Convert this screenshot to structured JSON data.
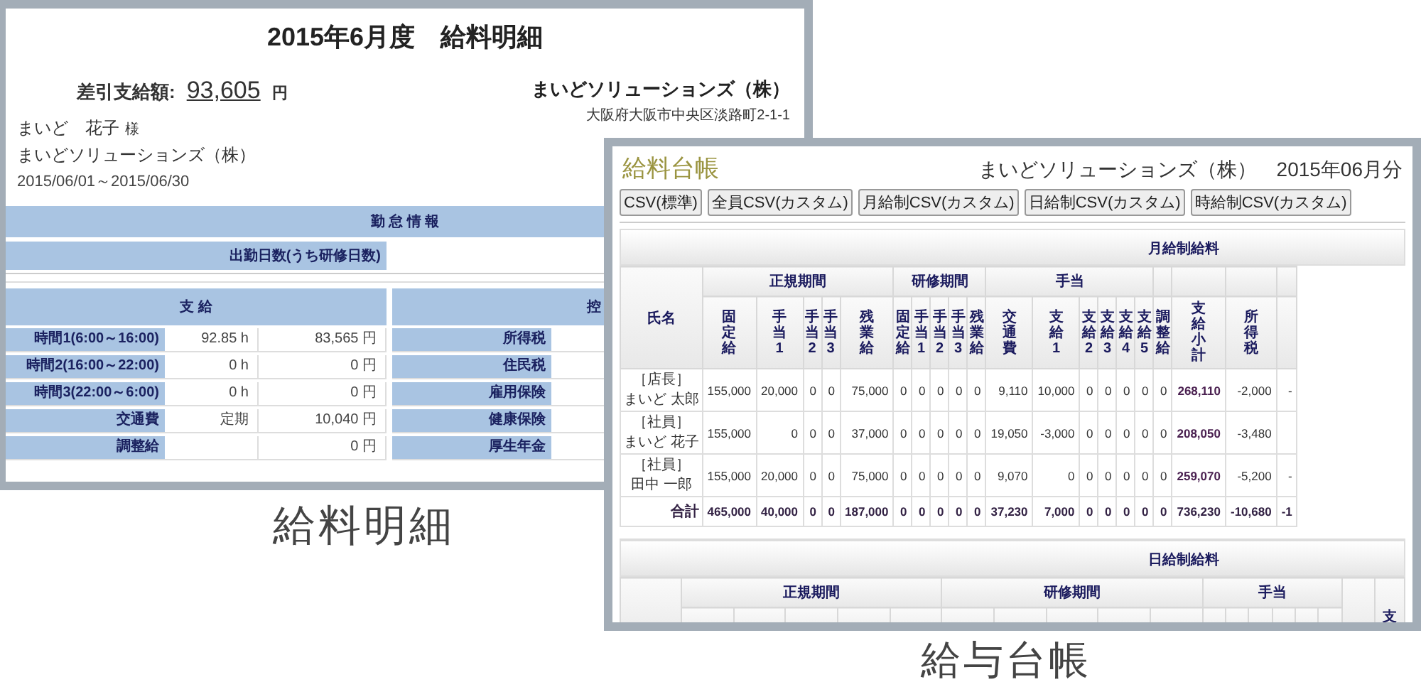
{
  "payslip": {
    "title": "2015年6月度　給料明細",
    "net_pay": {
      "label": "差引支給額:",
      "amount": "93,605",
      "unit": "円"
    },
    "company": {
      "name": "まいどソリューションズ（株）",
      "address": "大阪府大阪市中央区淡路町2-1-1"
    },
    "employee": {
      "name": "まいど　花子",
      "honorific": "様",
      "company": "まいどソリューションズ（株）",
      "period": "2015/06/01～2015/06/30"
    },
    "attendance": {
      "header": "勤 怠 情 報",
      "rows": [
        {
          "label": "出勤日数(うち研修日数)"
        }
      ]
    },
    "pay": {
      "header": "支 給",
      "rows": [
        {
          "label": "時間1(6:00～16:00)",
          "qty": "92.85 h",
          "amount": "83,565 円"
        },
        {
          "label": "時間2(16:00～22:00)",
          "qty": "0 h",
          "amount": "0 円"
        },
        {
          "label": "時間3(22:00～6:00)",
          "qty": "0 h",
          "amount": "0 円"
        },
        {
          "label": "交通費",
          "qty": "定期",
          "amount": "10,040 円"
        },
        {
          "label": "調整給",
          "amount": "0 円"
        }
      ]
    },
    "deductions": {
      "header": "控",
      "rows": [
        {
          "label": "所得税"
        },
        {
          "label": "住民税"
        },
        {
          "label": "雇用保険"
        },
        {
          "label": "健康保険"
        },
        {
          "label": "厚生年金"
        }
      ]
    }
  },
  "payslip_caption": "給料明細",
  "ledger": {
    "title": "給料台帳",
    "company_period": "まいどソリューションズ（株）　2015年06月分",
    "buttons": [
      "CSV(標準)",
      "全員CSV(カスタム)",
      "月給制CSV(カスタム)",
      "日給制CSV(カスタム)",
      "時給制CSV(カスタム)"
    ],
    "monthly": {
      "header": "月給制給料",
      "name_header": "氏名",
      "groups": [
        {
          "label": "正規期間",
          "columns": [
            {
              "label": "固定給",
              "emphasis": false
            },
            {
              "label": "手当1",
              "emphasis": false
            },
            {
              "label": "手当2",
              "emphasis": false
            },
            {
              "label": "手当3",
              "emphasis": false
            },
            {
              "label": "残業給",
              "emphasis": false
            }
          ]
        },
        {
          "label": "研修期間",
          "columns": [
            {
              "label": "固定給",
              "emphasis": false
            },
            {
              "label": "手当1",
              "emphasis": false
            },
            {
              "label": "手当2",
              "emphasis": false
            },
            {
              "label": "手当3",
              "emphasis": false
            },
            {
              "label": "残業給",
              "emphasis": false
            }
          ]
        },
        {
          "label": "手当",
          "columns": [
            {
              "label": "交通費",
              "emphasis": false
            },
            {
              "label": "支給1",
              "emphasis": false
            },
            {
              "label": "支給2",
              "emphasis": false
            },
            {
              "label": "支給3",
              "emphasis": false
            },
            {
              "label": "支給4",
              "emphasis": false
            },
            {
              "label": "支給5",
              "emphasis": false
            }
          ]
        },
        {
          "columns": [
            {
              "label": "調整給",
              "emphasis": false
            }
          ]
        },
        {
          "columns": [
            {
              "label": "支給小計",
              "emphasis": true
            }
          ]
        },
        {
          "columns": [
            {
              "label": "所得税",
              "emphasis": false
            }
          ]
        }
      ],
      "rows": [
        {
          "position": "［店長］",
          "name": "まいど 太郎",
          "values": [
            "155,000",
            "20,000",
            "0",
            "0",
            "75,000",
            "0",
            "0",
            "0",
            "0",
            "0",
            "9,110",
            "10,000",
            "0",
            "0",
            "0",
            "0",
            "0",
            "268,110",
            "-2,000",
            "-"
          ]
        },
        {
          "position": "［社員］",
          "name": "まいど 花子",
          "values": [
            "155,000",
            "0",
            "0",
            "0",
            "37,000",
            "0",
            "0",
            "0",
            "0",
            "0",
            "19,050",
            "-3,000",
            "0",
            "0",
            "0",
            "0",
            "0",
            "208,050",
            "-3,480"
          ]
        },
        {
          "position": "［社員］",
          "name": "田中 一郎",
          "values": [
            "155,000",
            "20,000",
            "0",
            "0",
            "75,000",
            "0",
            "0",
            "0",
            "0",
            "0",
            "9,070",
            "0",
            "0",
            "0",
            "0",
            "0",
            "0",
            "259,070",
            "-5,200",
            "-"
          ]
        }
      ],
      "total": {
        "label": "合計",
        "values": [
          "465,000",
          "40,000",
          "0",
          "0",
          "187,000",
          "0",
          "0",
          "0",
          "0",
          "0",
          "37,230",
          "7,000",
          "0",
          "0",
          "0",
          "0",
          "0",
          "736,230",
          "-10,680",
          "-1"
        ]
      }
    },
    "daily": {
      "header": "日給制給料",
      "groups": [
        "正規期間",
        "研修期間",
        "手当"
      ],
      "column_fragment": "支"
    }
  },
  "ledger_caption": "給与台帳"
}
